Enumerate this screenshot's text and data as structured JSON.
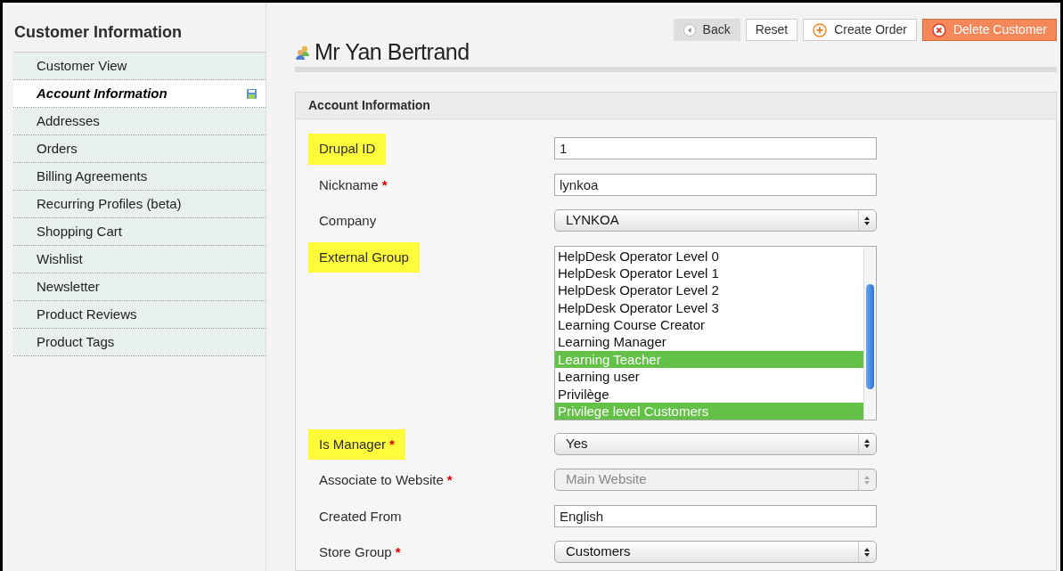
{
  "sidebar": {
    "title": "Customer Information",
    "items": [
      {
        "label": "Customer View",
        "selected": false,
        "changed": false
      },
      {
        "label": "Account Information",
        "selected": true,
        "changed": true
      },
      {
        "label": "Addresses",
        "selected": false,
        "changed": false
      },
      {
        "label": "Orders",
        "selected": false,
        "changed": false
      },
      {
        "label": "Billing Agreements",
        "selected": false,
        "changed": false
      },
      {
        "label": "Recurring Profiles (beta)",
        "selected": false,
        "changed": false
      },
      {
        "label": "Shopping Cart",
        "selected": false,
        "changed": false
      },
      {
        "label": "Wishlist",
        "selected": false,
        "changed": false
      },
      {
        "label": "Newsletter",
        "selected": false,
        "changed": false
      },
      {
        "label": "Product Reviews",
        "selected": false,
        "changed": false
      },
      {
        "label": "Product Tags",
        "selected": false,
        "changed": false
      }
    ]
  },
  "page_title": "Mr Yan Bertrand",
  "buttons": [
    {
      "label": "Back",
      "kind": "back"
    },
    {
      "label": "Reset",
      "kind": "plain"
    },
    {
      "label": "Create Order",
      "kind": "add"
    },
    {
      "label": "Delete Customer",
      "kind": "delete"
    }
  ],
  "section": {
    "title": "Account Information",
    "fields": [
      {
        "label": "Drupal ID",
        "kind": "text",
        "value": "1",
        "required": false,
        "highlighted": true
      },
      {
        "label": "Nickname",
        "kind": "text",
        "value": "lynkoa",
        "required": true,
        "required_mark": "*",
        "highlighted": false
      },
      {
        "label": "Company",
        "kind": "select",
        "value": "LYNKOA",
        "required": false,
        "highlighted": false,
        "disabled": false
      },
      {
        "label": "External Group",
        "kind": "listbox",
        "required": false,
        "highlighted": true,
        "options": [
          {
            "label": "HelpDesk Operator Level 0",
            "selected": false
          },
          {
            "label": "HelpDesk Operator Level 1",
            "selected": false
          },
          {
            "label": "HelpDesk Operator Level 2",
            "selected": false
          },
          {
            "label": "HelpDesk Operator Level 3",
            "selected": false
          },
          {
            "label": "Learning Course Creator",
            "selected": false
          },
          {
            "label": "Learning Manager",
            "selected": false
          },
          {
            "label": "Learning Teacher",
            "selected": true
          },
          {
            "label": "Learning user",
            "selected": false
          },
          {
            "label": "Privilège",
            "selected": false
          },
          {
            "label": "Privilege level Customers",
            "selected": true
          }
        ]
      },
      {
        "label": "Is Manager",
        "kind": "select",
        "value": "Yes",
        "required": true,
        "required_mark": "*",
        "highlighted": true,
        "disabled": false
      },
      {
        "label": "Associate to Website",
        "kind": "select",
        "value": "Main Website",
        "required": true,
        "required_mark": "*",
        "highlighted": false,
        "disabled": true
      },
      {
        "label": "Created From",
        "kind": "text",
        "value": "English",
        "required": false,
        "highlighted": false
      },
      {
        "label": "Store Group",
        "kind": "select",
        "value": "Customers",
        "required": true,
        "required_mark": "*",
        "highlighted": false,
        "disabled": false
      }
    ]
  }
}
